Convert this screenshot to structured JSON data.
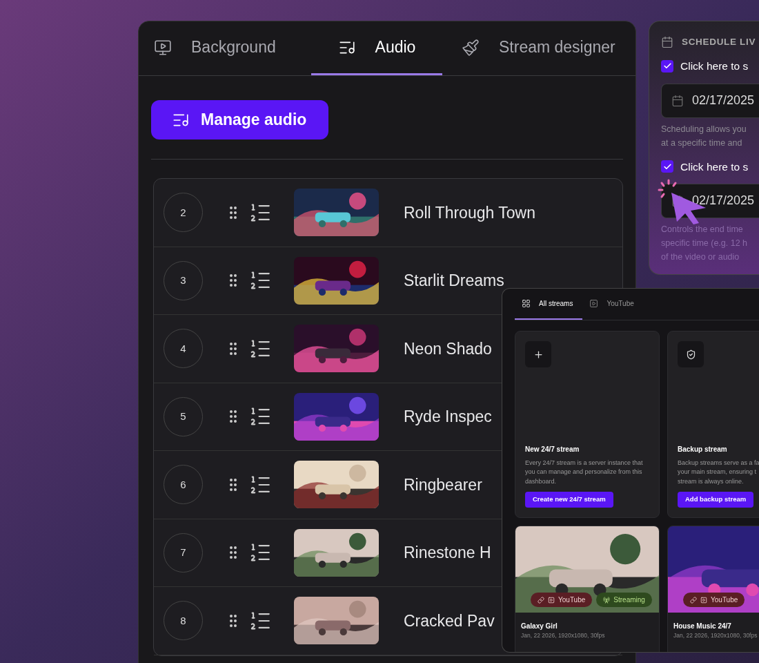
{
  "audio_panel": {
    "tabs": [
      {
        "label": "Background",
        "selected": false
      },
      {
        "label": "Audio",
        "selected": true
      },
      {
        "label": "Stream designer",
        "selected": false
      }
    ],
    "manage_button": "Manage audio",
    "tracks": [
      {
        "number": "2",
        "title": "Roll Through Town"
      },
      {
        "number": "3",
        "title": "Starlit Dreams"
      },
      {
        "number": "4",
        "title": "Neon Shado"
      },
      {
        "number": "5",
        "title": "Ryde Inspec"
      },
      {
        "number": "6",
        "title": "Ringbearer"
      },
      {
        "number": "7",
        "title": "Rinestone H"
      },
      {
        "number": "8",
        "title": "Cracked Pav"
      }
    ]
  },
  "schedule_panel": {
    "title": "SCHEDULE LIV",
    "options": [
      {
        "label": "Click here to s",
        "checked": true,
        "date": "02/17/2025",
        "help": [
          "Scheduling allows you",
          "at a specific time and"
        ]
      },
      {
        "label": "Click here to s",
        "checked": true,
        "date": "02/17/2025",
        "help": [
          "Controls the end time",
          "specific time (e.g. 12 h",
          "of the video or audio"
        ]
      }
    ]
  },
  "streams_panel": {
    "tabs": [
      {
        "label": "All streams",
        "selected": true
      },
      {
        "label": "YouTube",
        "selected": false
      }
    ],
    "action_cards": [
      {
        "title": "New 24/7 stream",
        "description": [
          "Every 24/7 stream is a server instance that",
          "you can manage and personalize from this",
          "dashboard."
        ],
        "button": "Create new 24/7 stream"
      },
      {
        "title": "Backup stream",
        "description": [
          "Backup streams serve as a fa",
          "your main stream, ensuring t",
          "stream is always online."
        ],
        "button": "Add backup stream"
      }
    ],
    "streams": [
      {
        "name": "Galaxy Girl",
        "details": "Jan, 22 2026, 1920x1080, 30fps",
        "badges": [
          {
            "kind": "platform",
            "label": "YouTube"
          },
          {
            "kind": "status",
            "label": "Streaming"
          }
        ]
      },
      {
        "name": "House Music 24/7",
        "details": "Jan, 22 2026, 1920x1080, 30fps",
        "badges": [
          {
            "kind": "platform",
            "label": "YouTube"
          }
        ]
      }
    ]
  }
}
